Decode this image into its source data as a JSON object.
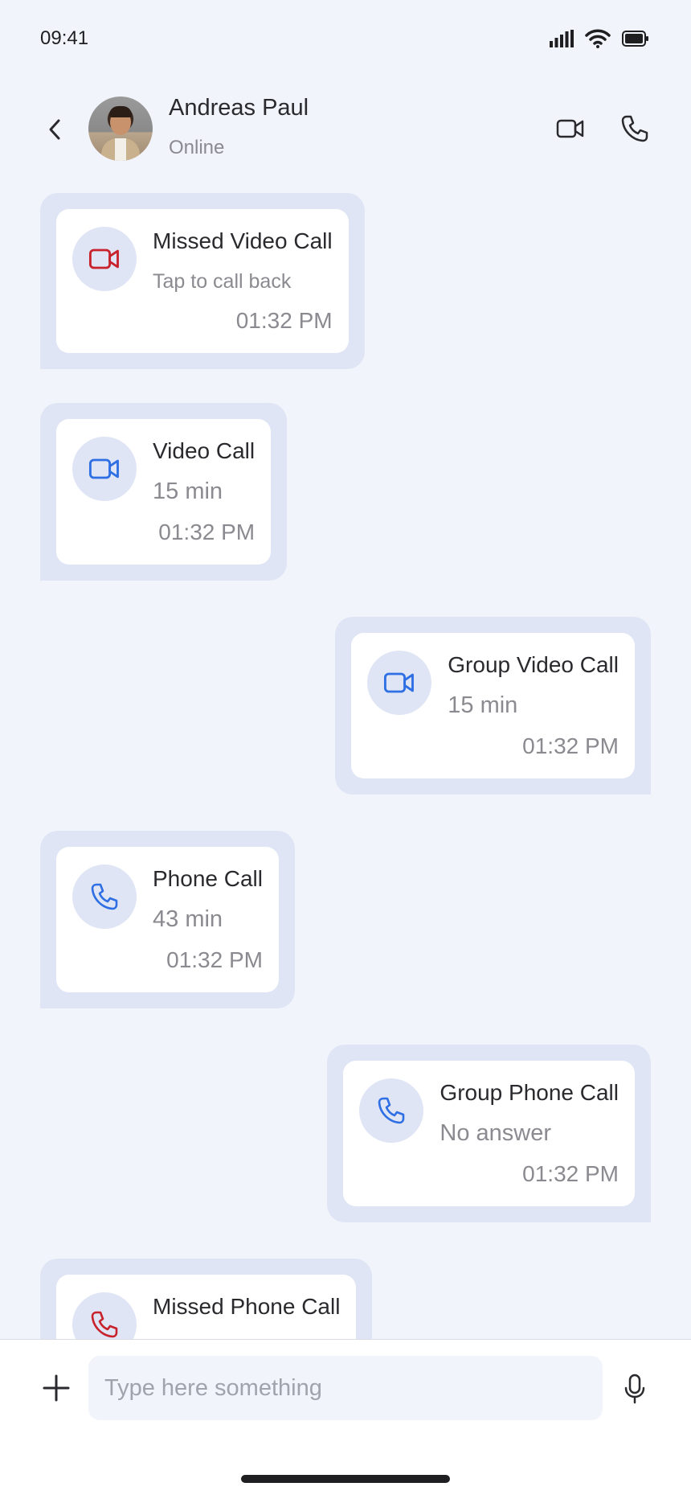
{
  "status_bar": {
    "time": "09:41"
  },
  "header": {
    "contact_name": "Andreas Paul",
    "contact_status": "Online"
  },
  "calls": [
    {
      "title": "Missed Video Call",
      "subtitle": "Tap to call back",
      "time": "01:32 PM",
      "icon": "video-icon",
      "color": "#C8232C",
      "side": "left"
    },
    {
      "title": "Video Call",
      "subtitle": "15 min",
      "time": "01:32 PM",
      "icon": "video-icon",
      "color": "#2F6FE4",
      "side": "left"
    },
    {
      "title": "Group Video Call",
      "subtitle": "15 min",
      "time": "01:32 PM",
      "icon": "video-icon",
      "color": "#2F6FE4",
      "side": "right"
    },
    {
      "title": "Phone Call",
      "subtitle": "43 min",
      "time": "01:32 PM",
      "icon": "phone-icon",
      "color": "#2F6FE4",
      "side": "left"
    },
    {
      "title": "Group Phone Call",
      "subtitle": "No answer",
      "time": "01:32 PM",
      "icon": "phone-icon",
      "color": "#2F6FE4",
      "side": "right"
    },
    {
      "title": "Missed Phone Call",
      "subtitle": "",
      "time": "",
      "icon": "phone-icon",
      "color": "#C8232C",
      "side": "left"
    }
  ],
  "composer": {
    "placeholder": "Type here something"
  },
  "colors": {
    "background": "#F1F4FA",
    "bubble": "#DFE5F5",
    "accent_blue": "#2F6FE4",
    "missed_red": "#C8232C"
  }
}
